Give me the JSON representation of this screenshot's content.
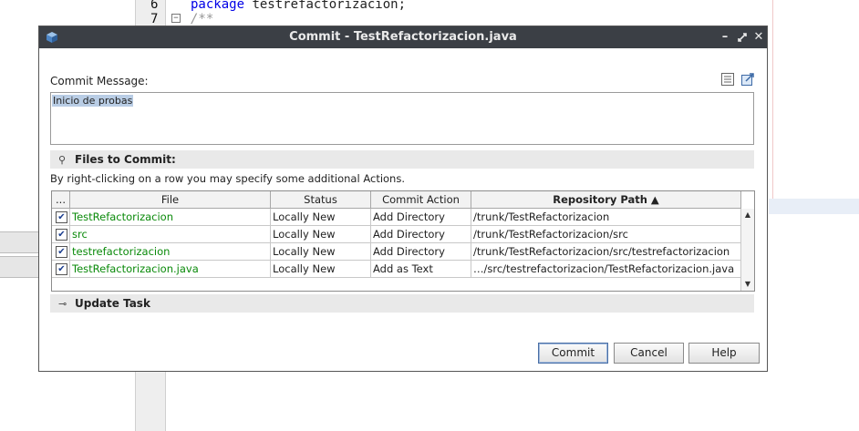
{
  "editor": {
    "lines": [
      {
        "num": "6",
        "keyword": "package",
        "text": " testrefactorizacion;"
      },
      {
        "num": "7",
        "fold": "−",
        "comment": "/**"
      }
    ]
  },
  "dialog": {
    "title": "Commit - TestRefactorizacion.java",
    "commit_message_label": "Commit Message:",
    "commit_message": "Inicio de probas",
    "files_section_label": "Files to Commit:",
    "hint": "By right-clicking on a row you may specify some additional Actions.",
    "table": {
      "columns": [
        "...",
        "File",
        "Status",
        "Commit Action",
        "Repository Path ▲"
      ],
      "rows": [
        {
          "file": "TestRefactorizacion",
          "status": "Locally New",
          "action": "Add Directory",
          "path": "/trunk/TestRefactorizacion"
        },
        {
          "file": "src",
          "status": "Locally New",
          "action": "Add Directory",
          "path": "/trunk/TestRefactorizacion/src"
        },
        {
          "file": "testrefactorizacion",
          "status": "Locally New",
          "action": "Add Directory",
          "path": "/trunk/TestRefactorizacion/src/testrefactorizacion"
        },
        {
          "file": "TestRefactorizacion.java",
          "status": "Locally New",
          "action": "Add as Text",
          "path": "…/src/testrefactorizacion/TestRefactorizacion.java"
        }
      ]
    },
    "update_section_label": "Update Task",
    "buttons": {
      "commit": "Commit",
      "cancel": "Cancel",
      "help": "Help"
    }
  },
  "colors": {
    "titlebar": "#3b3f45",
    "file_green": "#0a8a0a",
    "selection": "#b9cde5"
  }
}
